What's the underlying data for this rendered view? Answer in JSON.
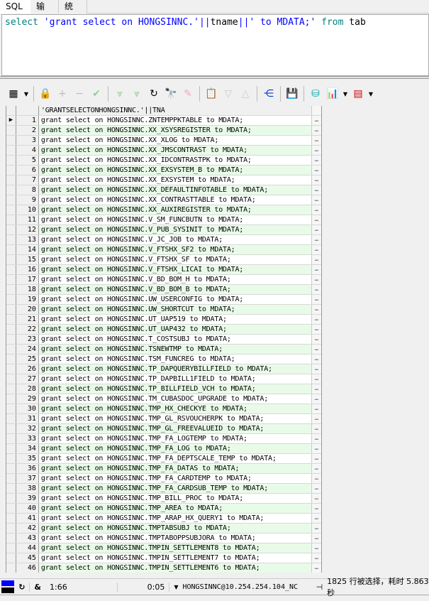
{
  "tabs": [
    "SQL",
    "输出",
    "统计"
  ],
  "editor": {
    "select": "select",
    "str1": "'grant select on HONGSINNC.'",
    "op1": "||",
    "ident": "tname",
    "op2": "||",
    "str2": "' to MDATA;'",
    "from": "from",
    "table": "tab"
  },
  "toolbar": {
    "icons": [
      "grid-options-icon",
      "lock-icon",
      "add-record-icon",
      "delete-record-icon",
      "post-icon",
      "fetch-next-icon",
      "fetch-last-icon",
      "refresh-icon",
      "find-icon",
      "clear-icon",
      "query-by-example-icon",
      "sort-desc-icon",
      "sort-asc-icon",
      "tree-view-icon",
      "save-icon",
      "export-icon",
      "chart-icon",
      "table-view-icon"
    ]
  },
  "grid": {
    "column_header": "'GRANTSELECTONHONGSINNC.'||TNA",
    "prefix": "grant select on HONGSINNC.",
    "suffix": " to MDATA;",
    "tables": [
      "ZNTEMPPKTABLE",
      "XX_XSYSREGISTER",
      "XX_XLOG",
      "XX_JMSCONTRAST",
      "XX_IDCONTRASTPK",
      "XX_EXSYSTEM_B",
      "XX_EXSYSTEM",
      "XX_DEFAULTINFOTABLE",
      "XX_CONTRASTTABLE",
      "XX_AUXIREGISTER",
      "V_SM_FUNCBUTN",
      "V_PUB_SYSINIT",
      "V_JC_JOB",
      "V_FTSHX_SF2",
      "V_FTSHX_SF",
      "V_FTSHX_LICAI",
      "V_BD_BOM_H",
      "V_BD_BOM_B",
      "UW_USERCONFIG",
      "UW_SHORTCUT",
      "UT_UAP519",
      "UT_UAP432",
      "T_COSTSUBJ",
      "TSNEWTMP",
      "TSM_FUNCREG",
      "TP_DAPQUERYBILLFIELD",
      "TP_DAPBILL1FIELD",
      "TP_BILLFIELD_VCH",
      "TM_CUBASDOC_UPGRADE",
      "TMP_HX_CHECKYE",
      "TMP_GL_RSVOUCHERPK",
      "TMP_GL_FREEVALUEID",
      "TMP_FA_LOGTEMP",
      "TMP_FA_LOG",
      "TMP_FA_DEPTSCALE_TEMP",
      "TMP_FA_DATAS",
      "TMP_FA_CARDTEMP",
      "TMP_FA_CARDSUB_TEMP",
      "TMP_BILL_PROC",
      "TMP_AREA",
      "TMP_ARAP_HX_QUERY1",
      "TMPTABSUBJ",
      "TMPTABOPPSUBJORA",
      "TMPIN_SETTLEMENT8",
      "TMPIN_SETTLEMENT7",
      "TMPIN_SETTLEMENT6"
    ],
    "ellipsis": "…",
    "current_row_marker": "▶"
  },
  "status": {
    "amp": "&",
    "cursor": "1:66",
    "elapsed": "0:05",
    "connection": "HONGSINNC@10.254.254.104_NC",
    "result": "1825 行被选择，耗时 5.863 秒"
  }
}
